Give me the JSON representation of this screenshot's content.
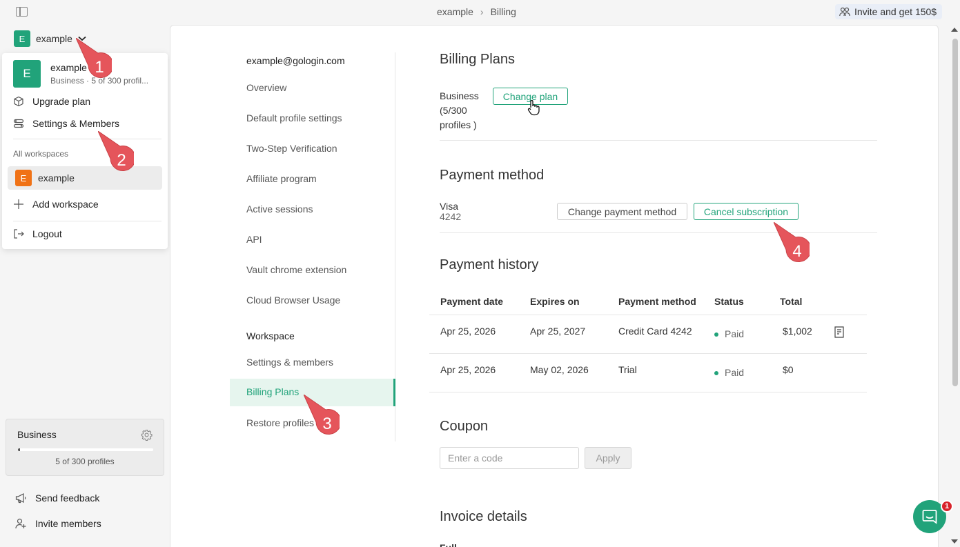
{
  "breadcrumb": {
    "workspace": "example",
    "page": "Billing"
  },
  "invite_chip": "Invite and get 150$",
  "workspace_switcher": {
    "avatar_letter": "E",
    "name": "example"
  },
  "dropdown": {
    "avatar_letter": "E",
    "name": "example",
    "sub": "Business · 5 of 300 profil...",
    "upgrade": "Upgrade plan",
    "settings": "Settings & Members",
    "all_workspaces": "All workspaces",
    "ws_letter": "E",
    "ws_name": "example",
    "add": "Add workspace",
    "logout": "Logout"
  },
  "plan_card": {
    "title": "Business",
    "count": "5 of 300 profiles",
    "usage_fraction": 0.017
  },
  "side_links": {
    "feedback": "Send feedback",
    "invite": "Invite members"
  },
  "settings_nav": {
    "email": "example@gologin.com",
    "items": [
      "Overview",
      "Default profile settings",
      "Two-Step Verification",
      "Affiliate program",
      "Active sessions",
      "API",
      "Vault chrome extension",
      "Cloud Browser Usage"
    ],
    "workspace_heading": "Workspace",
    "ws_items": [
      "Settings & members",
      "Billing Plans",
      "Restore profiles"
    ]
  },
  "billing": {
    "title": "Billing Plans",
    "plan_line1": "Business",
    "plan_line2": "(5/300",
    "plan_line3": "profiles )",
    "change_plan": "Change plan"
  },
  "payment_method": {
    "title": "Payment method",
    "card": "Visa",
    "last4": "4242",
    "change": "Change payment method",
    "cancel": "Cancel subscription"
  },
  "payment_history": {
    "title": "Payment history",
    "headers": [
      "Payment date",
      "Expires on",
      "Payment method",
      "Status",
      "Total"
    ],
    "rows": [
      [
        "Apr 25, 2026",
        "Apr 25, 2027",
        "Credit Card 4242",
        "Paid",
        "$1,002"
      ],
      [
        "Apr 25, 2026",
        "May 02, 2026",
        "Trial",
        "Paid",
        "$0"
      ]
    ]
  },
  "coupon": {
    "title": "Coupon",
    "placeholder": "Enter a code",
    "apply": "Apply"
  },
  "invoice": {
    "title": "Invoice details",
    "partial": "Full"
  },
  "chat_badge": "1",
  "callouts": [
    "1",
    "2",
    "3",
    "4"
  ],
  "colors": {
    "accent": "#21a37a",
    "callout": "#e5555b",
    "orange": "#f07216"
  }
}
